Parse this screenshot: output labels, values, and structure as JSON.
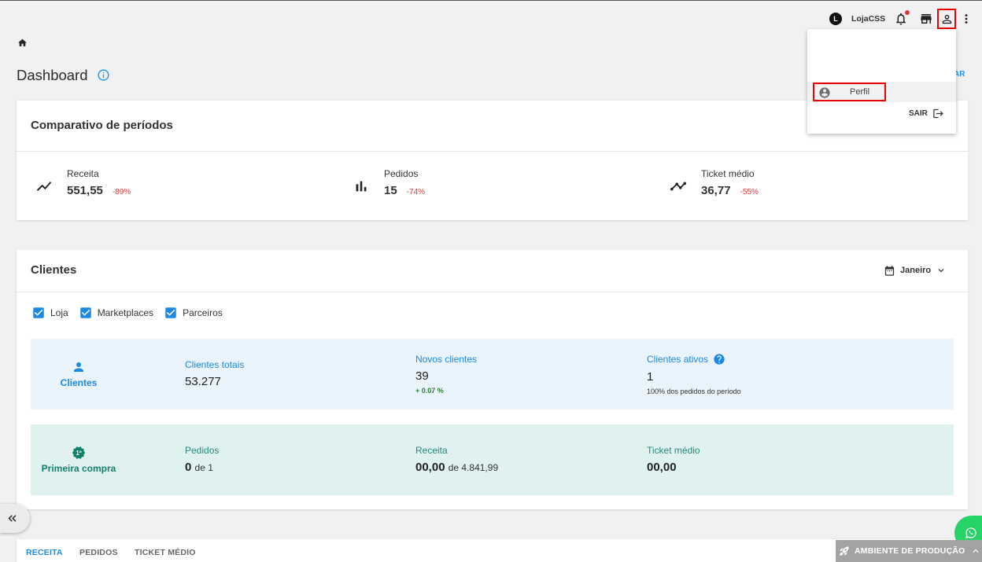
{
  "topbar": {
    "avatar_letter": "L",
    "store_name": "LojaCSS",
    "has_unread_notifications": true
  },
  "user_menu": {
    "open": true,
    "profile_label": "Perfil",
    "profile_icon": "account-circle-icon",
    "logout_label": "SAIR",
    "logout_icon": "logout-icon"
  },
  "page": {
    "title": "Dashboard",
    "header_action_partial": "AR"
  },
  "comparison": {
    "title": "Comparativo de períodos",
    "metrics": [
      {
        "icon": "show-chart-icon",
        "label": "Receita",
        "value": "551,55",
        "change": "-89%"
      },
      {
        "icon": "bar-chart-icon",
        "label": "Pedidos",
        "value": "15",
        "change": "-74%"
      },
      {
        "icon": "timeline-icon",
        "label": "Ticket médio",
        "value": "36,77",
        "change": "-55%"
      }
    ]
  },
  "clients": {
    "title": "Clientes",
    "period": "Janeiro",
    "filters": [
      {
        "label": "Loja",
        "checked": true
      },
      {
        "label": "Marketplaces",
        "checked": true
      },
      {
        "label": "Parceiros",
        "checked": true
      }
    ],
    "summary": {
      "heading": "Clientes",
      "icon": "person-icon",
      "stats": [
        {
          "label": "Clientes totais",
          "value": "53.277"
        },
        {
          "label": "Novos clientes",
          "value": "39",
          "note": "+ 0.07 %"
        },
        {
          "label": "Clientes ativos",
          "value": "1",
          "note": "100% dos pedidos do período",
          "help_icon": "help-icon"
        }
      ]
    },
    "first_purchase": {
      "heading": "Primeira compra",
      "badge_text": "1º",
      "stats": [
        {
          "label": "Pedidos",
          "value": "0",
          "suffix": "de 1"
        },
        {
          "label": "Receita",
          "value": "00,00",
          "suffix": "de 4.841,99"
        },
        {
          "label": "Ticket médio",
          "value": "00,00"
        }
      ]
    }
  },
  "bottom_tabs": [
    {
      "label": "RECEITA",
      "active": true
    },
    {
      "label": "PEDIDOS",
      "active": false
    },
    {
      "label": "TICKET MÉDIO",
      "active": false
    }
  ],
  "environment_banner": {
    "label": "AMBIENTE DE PRODUÇÃO",
    "icon": "rocket-icon"
  },
  "colors": {
    "accent": "#1e88e5",
    "negative": "#e53935",
    "positive": "#2e7d32",
    "teal": "#11806a",
    "clients_panel_bg": "#e9f4fc",
    "first_purchase_panel_bg": "#e0f2ef",
    "highlight": "#e00000",
    "whatsapp": "#25d366",
    "environment_bg": "#a3a3a3"
  }
}
